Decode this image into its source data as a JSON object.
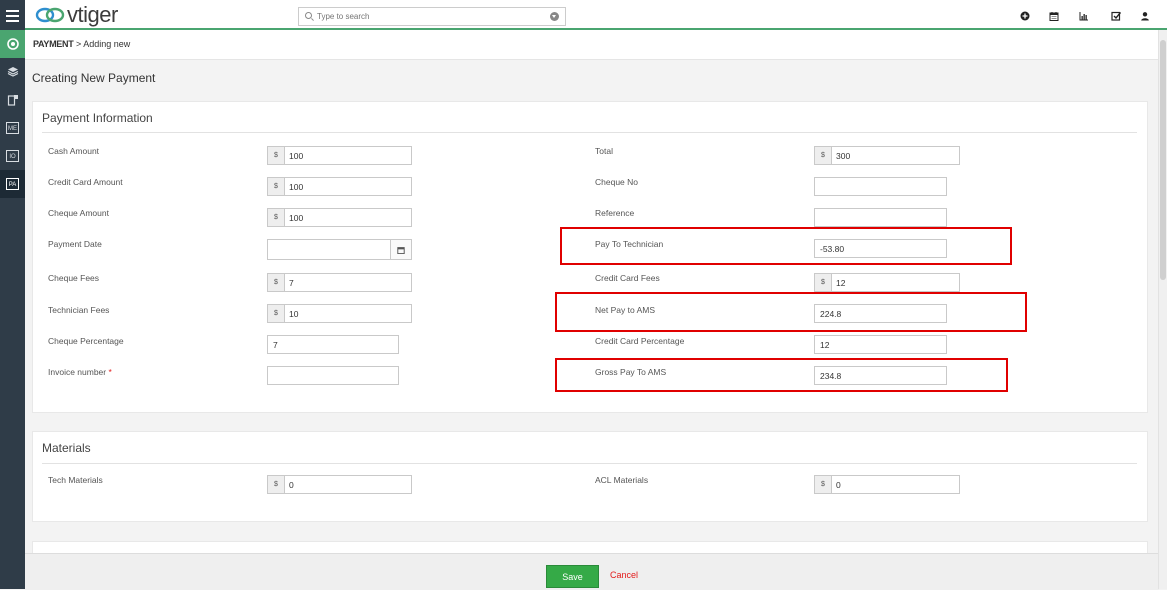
{
  "app": {
    "brand": "vtiger",
    "accent": "#4aa570",
    "highlight": "#e00000"
  },
  "search": {
    "placeholder": "Type to search"
  },
  "topbar_icons": [
    "plus-circle-icon",
    "calendar-icon",
    "bar-chart-icon",
    "check-square-icon",
    "user-icon"
  ],
  "rail": [
    {
      "icon": "target-icon"
    },
    {
      "icon": "cube-icon"
    },
    {
      "icon": "card-icon"
    },
    {
      "label": "ME"
    },
    {
      "label": "IO"
    },
    {
      "label": "PA"
    }
  ],
  "breadcrumb": {
    "module": "PAYMENT",
    "separator": ">",
    "page": "Adding new"
  },
  "page_title": "Creating New Payment",
  "payment_info": {
    "heading": "Payment Information",
    "cash_amount": {
      "label": "Cash Amount",
      "currency": "$",
      "value": "100"
    },
    "total": {
      "label": "Total",
      "currency": "$",
      "value": "300"
    },
    "credit_card_amount": {
      "label": "Credit Card Amount",
      "currency": "$",
      "value": "100"
    },
    "cheque_no": {
      "label": "Cheque No",
      "value": ""
    },
    "cheque_amount": {
      "label": "Cheque Amount",
      "currency": "$",
      "value": "100"
    },
    "reference": {
      "label": "Reference",
      "value": ""
    },
    "payment_date": {
      "label": "Payment Date",
      "value": ""
    },
    "pay_to_technician": {
      "label": "Pay To Technician",
      "value": "-53.80"
    },
    "cheque_fees": {
      "label": "Cheque Fees",
      "currency": "$",
      "value": "7"
    },
    "credit_card_fees": {
      "label": "Credit Card Fees",
      "currency": "$",
      "value": "12"
    },
    "technician_fees": {
      "label": "Technician Fees",
      "currency": "$",
      "value": "10"
    },
    "net_pay_to_ams": {
      "label": "Net Pay to AMS",
      "value": "224.8"
    },
    "cheque_percentage": {
      "label": "Cheque Percentage",
      "value": "7"
    },
    "credit_card_percentage": {
      "label": "Credit Card Percentage",
      "value": "12"
    },
    "invoice_number": {
      "label": "Invoice number",
      "required_mark": "*",
      "value": ""
    },
    "gross_pay_to_ams": {
      "label": "Gross Pay To AMS",
      "value": "234.8"
    }
  },
  "materials": {
    "heading": "Materials",
    "tech_materials": {
      "label": "Tech Materials",
      "currency": "$",
      "value": "0"
    },
    "acl_materials": {
      "label": "ACL Materials",
      "currency": "$",
      "value": "0"
    }
  },
  "footer": {
    "save_label": "Save",
    "cancel_label": "Cancel"
  }
}
